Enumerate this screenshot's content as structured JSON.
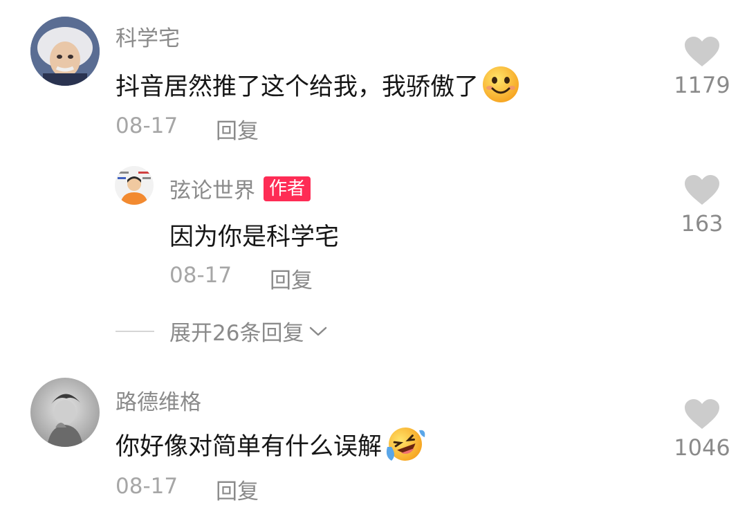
{
  "comments": [
    {
      "username": "科学宅",
      "text": "抖音居然推了这个给我，我骄傲了",
      "emoji": "smile-emoji",
      "date": "08-17",
      "reply_label": "回复",
      "likes": "1179",
      "reply": {
        "username": "弦论世界",
        "badge": "作者",
        "text": "因为你是科学宅",
        "date": "08-17",
        "reply_label": "回复",
        "likes": "163"
      },
      "expand_label": "展开26条回复"
    },
    {
      "username": "路德维格",
      "text": "你好像对简单有什么误解",
      "emoji": "laugh-cry-emoji",
      "date": "08-17",
      "reply_label": "回复",
      "likes": "1046"
    }
  ],
  "colors": {
    "author_badge": "#fe2c55",
    "heart": "#cccccc",
    "secondary_text": "#8a8a8a"
  }
}
